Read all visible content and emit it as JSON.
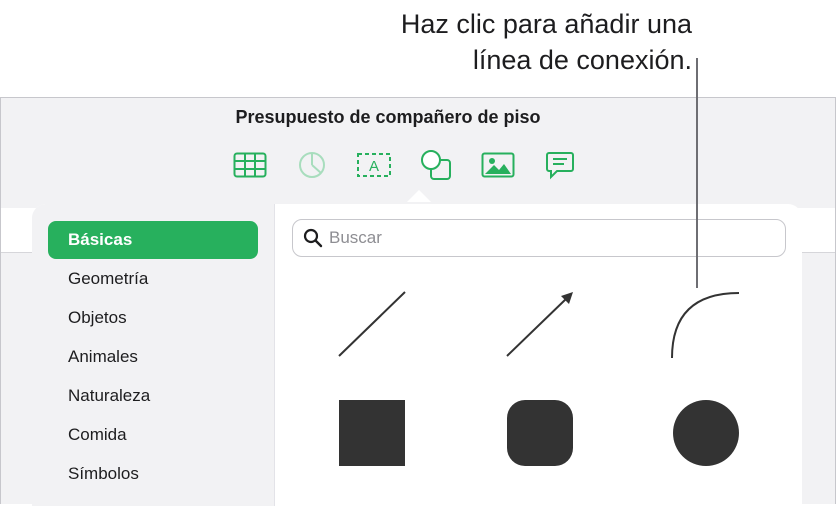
{
  "callout": {
    "line1": "Haz clic para añadir una",
    "line2": "línea de conexión."
  },
  "window": {
    "title": "Presupuesto de compañero de piso"
  },
  "toolbar": {
    "accent": "#27b05d",
    "items": [
      {
        "icon": "table-icon",
        "state": "enabled"
      },
      {
        "icon": "chart-icon",
        "state": "disabled"
      },
      {
        "icon": "text-box-icon",
        "state": "enabled"
      },
      {
        "icon": "shape-icon",
        "state": "selected"
      },
      {
        "icon": "media-icon",
        "state": "enabled"
      },
      {
        "icon": "comment-icon",
        "state": "enabled"
      }
    ]
  },
  "shapes_popover": {
    "categories": [
      {
        "label": "Básicas",
        "selected": true
      },
      {
        "label": "Geometría",
        "selected": false
      },
      {
        "label": "Objetos",
        "selected": false
      },
      {
        "label": "Animales",
        "selected": false
      },
      {
        "label": "Naturaleza",
        "selected": false
      },
      {
        "label": "Comida",
        "selected": false
      },
      {
        "label": "Símbolos",
        "selected": false
      }
    ],
    "search": {
      "icon": "search-icon",
      "placeholder": "Buscar",
      "value": ""
    },
    "shapes": [
      {
        "name": "line-shape",
        "kind": "line"
      },
      {
        "name": "arrow-line-shape",
        "kind": "arrow"
      },
      {
        "name": "connection-line-shape",
        "kind": "curve"
      },
      {
        "name": "square-shape",
        "kind": "square"
      },
      {
        "name": "rounded-square-shape",
        "kind": "rounded-square"
      },
      {
        "name": "circle-shape",
        "kind": "circle"
      }
    ],
    "colors": {
      "selected_bg": "#27b05d",
      "shape_fill": "#333333"
    }
  }
}
